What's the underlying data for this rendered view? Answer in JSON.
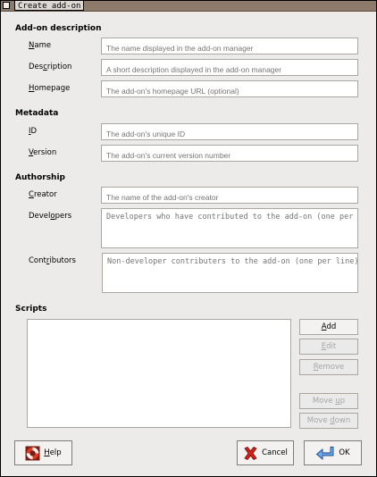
{
  "window": {
    "title": "Create add-on"
  },
  "sections": {
    "description": "Add-on description",
    "metadata": "Metadata",
    "authorship": "Authorship",
    "scripts": "Scripts"
  },
  "fields": {
    "name": {
      "label": "Name",
      "mnemonic": "N",
      "rest": "ame",
      "placeholder": "The name displayed in the add-on manager",
      "value": ""
    },
    "description": {
      "label": "Description",
      "pre": "Des",
      "mnemonic": "c",
      "rest": "ription",
      "placeholder": "A short description displayed in the add-on manager",
      "value": ""
    },
    "homepage": {
      "label": "Homepage",
      "mnemonic": "H",
      "rest": "omepage",
      "placeholder": "The add-on's homepage URL (optional)",
      "value": ""
    },
    "id": {
      "label": "ID",
      "mnemonic": "I",
      "rest": "D",
      "placeholder": "The add-on's unique ID",
      "value": ""
    },
    "version": {
      "label": "Version",
      "mnemonic": "V",
      "rest": "ersion",
      "placeholder": "The add-on's current version number",
      "value": ""
    },
    "creator": {
      "label": "Creator",
      "mnemonic": "C",
      "rest": "reator",
      "placeholder": "The name of the add-on's creator",
      "value": ""
    },
    "developers": {
      "label": "Developers",
      "pre": "Devel",
      "mnemonic": "o",
      "rest": "pers",
      "placeholder": "Developers who have contributed to the add-on (one per line)",
      "value": ""
    },
    "contributors": {
      "label": "Contributors",
      "pre": "Cont",
      "mnemonic": "r",
      "rest": "ibutors",
      "placeholder": "Non-developer contributers to the add-on (one per line)",
      "value": ""
    }
  },
  "scripts": {
    "items": [],
    "buttons": {
      "add": {
        "label": "Add",
        "mnemonic": "A",
        "rest": "dd"
      },
      "edit": {
        "label": "Edit",
        "mnemonic": "E",
        "rest": "dit"
      },
      "remove": {
        "label": "Remove",
        "mnemonic": "R",
        "rest": "emove"
      },
      "move_up": {
        "label": "Move up",
        "pre": "Move ",
        "mnemonic": "u",
        "rest": "p"
      },
      "move_down": {
        "label": "Move down",
        "pre": "Move ",
        "mnemonic": "d",
        "rest": "own"
      }
    }
  },
  "dialog_buttons": {
    "help": {
      "label": "Help",
      "mnemonic": "H",
      "rest": "elp",
      "icon": "lifebuoy-icon"
    },
    "cancel": {
      "label": "Cancel",
      "icon": "red-x-icon"
    },
    "ok": {
      "label": "OK",
      "icon": "return-arrow-icon"
    }
  }
}
